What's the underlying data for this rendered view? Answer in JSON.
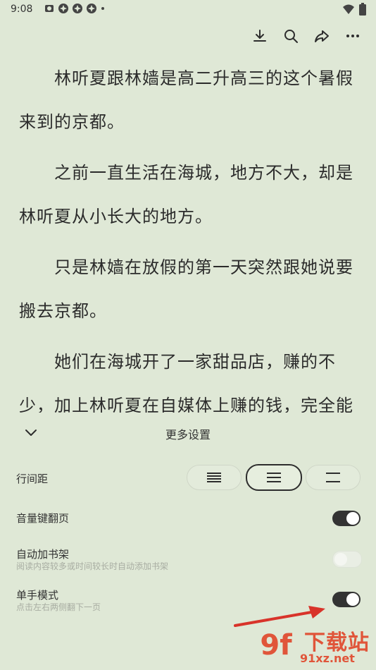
{
  "status_bar": {
    "time": "9:08"
  },
  "toolbar": {
    "icons": [
      "download-icon",
      "search-icon",
      "share-icon",
      "more-icon"
    ]
  },
  "reader": {
    "paragraphs": [
      "林听夏跟林嫱是高二升高三的这个暑假来到的京都。",
      "之前一直生活在海城，地方不大，却是林听夏从小长大的地方。",
      "只是林嫱在放假的第一天突然跟她说要搬去京都。",
      "她们在海城开了一家甜品店，赚的不少，加上林听夏在自媒体上赚的钱，完全能"
    ]
  },
  "settings": {
    "title": "更多设置",
    "line_spacing": {
      "label": "行间距",
      "options": [
        "dense",
        "medium",
        "wide"
      ],
      "selected_index": 1
    },
    "volume_page": {
      "label": "音量键翻页",
      "on": true
    },
    "auto_shelf": {
      "label": "自动加书架",
      "sub": "阅读内容较多或时间较长时自动添加书架",
      "on": false
    },
    "one_hand": {
      "label": "单手模式",
      "sub": "点击左右两侧翻下一页",
      "on": true
    }
  },
  "watermark": {
    "logo": "9f",
    "title": "下载站",
    "url": "91xz.net"
  },
  "colors": {
    "background": "#dfe8d6",
    "toggle_on": "#333333",
    "watermark": "#e0553a",
    "arrow": "#d8332a"
  }
}
